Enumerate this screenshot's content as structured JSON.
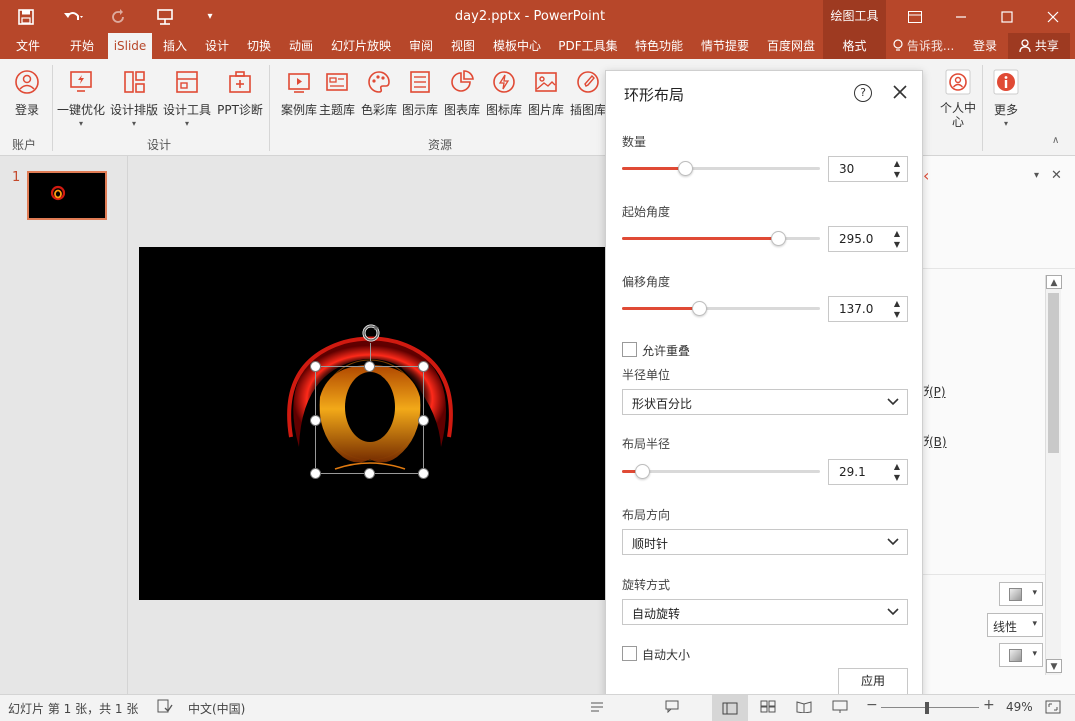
{
  "app": {
    "document_title": "day2.pptx - PowerPoint",
    "context_group": "绘图工具",
    "colors": {
      "accent": "#b7472a",
      "slider_fill": "#e04a35"
    }
  },
  "quick_access": {
    "save_icon": "save-icon",
    "undo_icon": "undo-icon",
    "redo_icon": "redo-icon",
    "present_icon": "present-icon",
    "customize_icon": "customize-icon"
  },
  "window_controls": {
    "ribbon_options_icon": "ribbon-display-icon",
    "minimize_icon": "minimize-icon",
    "maximize_icon": "maximize-icon",
    "close_icon": "close-icon"
  },
  "tabs": [
    {
      "label": "文件"
    },
    {
      "label": "开始"
    },
    {
      "label": "iSlide"
    },
    {
      "label": "插入"
    },
    {
      "label": "设计"
    },
    {
      "label": "切换"
    },
    {
      "label": "动画"
    },
    {
      "label": "幻灯片放映"
    },
    {
      "label": "审阅"
    },
    {
      "label": "视图"
    },
    {
      "label": "模板中心"
    },
    {
      "label": "PDF工具集"
    },
    {
      "label": "特色功能"
    },
    {
      "label": "情节提要"
    },
    {
      "label": "百度网盘"
    },
    {
      "label": "格式"
    }
  ],
  "tell_me": "告诉我...",
  "signin": "登录",
  "share": "共享",
  "ribbon": {
    "account": {
      "login": "登录",
      "group": "账户"
    },
    "design": {
      "items": [
        "一键优化",
        "设计排版",
        "设计工具",
        "PPT诊断"
      ],
      "group": "设计"
    },
    "resources": {
      "items": [
        "案例库",
        "主题库",
        "色彩库",
        "图示库",
        "图表库",
        "图标库",
        "图片库",
        "插图库"
      ],
      "group": "资源"
    },
    "right": {
      "personal": "个人中心",
      "more": "更多"
    }
  },
  "thumbs": {
    "number": "1"
  },
  "dialog": {
    "title": "环形布局",
    "count": {
      "label": "数量",
      "value": "30",
      "fraction": 0.32
    },
    "start_angle": {
      "label": "起始角度",
      "value": "295.0",
      "fraction": 0.79
    },
    "offset_angle": {
      "label": "偏移角度",
      "value": "137.0",
      "fraction": 0.39
    },
    "allow_overlap": {
      "label": "允许重叠",
      "checked": false
    },
    "radius_unit": {
      "label": "半径单位",
      "value": "形状百分比"
    },
    "layout_radius": {
      "label": "布局半径",
      "value": "29.1",
      "fraction": 0.1
    },
    "direction": {
      "label": "布局方向",
      "value": "顺时针"
    },
    "rotation": {
      "label": "旋转方式",
      "value": "自动旋转"
    },
    "auto_size": {
      "label": "自动大小",
      "checked": false
    },
    "apply": "应用"
  },
  "right_pane": {
    "hotkey_p": "(P)",
    "hotkey_b": "(B)",
    "dropdown_linear": "线性"
  },
  "status": {
    "slide_info": "幻灯片 第 1 张，共 1 张",
    "language": "中文(中国)",
    "zoom": "49%"
  }
}
